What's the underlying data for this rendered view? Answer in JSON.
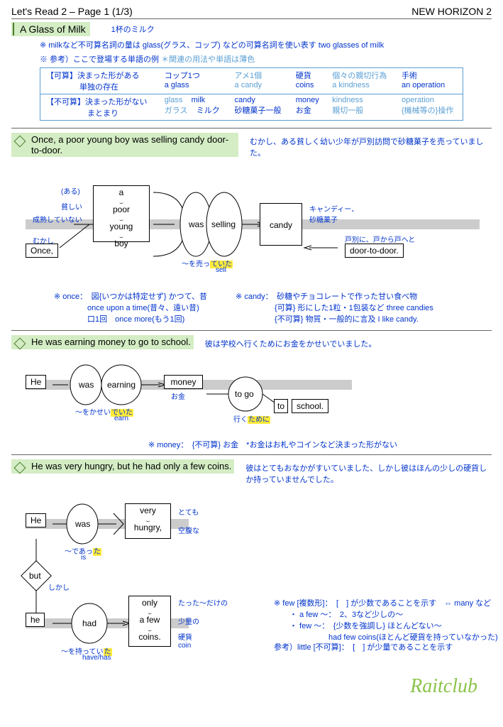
{
  "header": {
    "left": "Let's Read 2 – Page 1 (1/3)",
    "right": "NEW HORIZON 2"
  },
  "title": {
    "en": "A Glass of Milk",
    "jp": "1杯のミルク"
  },
  "note1": "※ milkなど不可算名詞の量は glass(グラス、コップ) などの可算名詞を使い表す two glasses of milk",
  "note2": "※ 参考）ここで登場する単語の例",
  "note2b": "＊関連の用法や単語は薄色",
  "vocab": {
    "r1_label": "【可算】決まった形がある\n　　　　 単独の存在",
    "r1c1": "コップ1つ",
    "r1c1b": "a glass",
    "r1c2": "アメ1個",
    "r1c2b": "a candy",
    "r1c3": "硬貨",
    "r1c3b": "coins",
    "r1c4": "個々の親切行為",
    "r1c4b": "a kindness",
    "r1c5": "手術",
    "r1c5b": "an operation",
    "r2_label": "【不可算】決まった形がない\n　　　　　 まとまり",
    "r2c1a": "glass",
    "r2c1aj": "ガラス",
    "r2c1b": "milk",
    "r2c1bj": "ミルク",
    "r2c2": "candy",
    "r2c2j": "砂糖菓子一般",
    "r2c3": "money",
    "r2c3j": "お金",
    "r2c4": "kindness",
    "r2c4j": "親切一般",
    "r2c5": "operation",
    "r2c5j": "{機械等の}操作"
  },
  "s1": {
    "en": "Once, a poor young boy was selling candy door-to-door.",
    "jp": "むかし、ある貧しく幼い少年が戸別訪問で砂糖菓子を売っていました。",
    "once": "Once,",
    "once_jp": "むかし",
    "a": "a",
    "poor": "poor",
    "young": "young",
    "boy": "boy",
    "a_jp": "(ある)",
    "poor_jp": "貧しい",
    "young_jp": "成熟していない",
    "was": "was",
    "selling": "selling",
    "sell_jp1": "～を売っ",
    "sell_jp2": "ていた",
    "sell_jp3": "sell",
    "candy": "candy",
    "candy_jp": "キャンディー、\n砂糖菓子",
    "door": "door-to-door.",
    "door_jp": "戸別に、戸から戸へと",
    "n1": "※ once：　図{いつかは特定せず} かつて、昔\n　　　　 once upon a time(昔々、遠い昔)\n　　　　 口1回　once more(もう1回)",
    "n2": "※ candy：　砂糖やチョコレートで作った甘い食べ物\n　　　　　{可算} 形にした1粒・1包装など three candies\n　　　　　{不可算} 物質・一般的に言及 I like candy."
  },
  "s2": {
    "en": "He was earning money to go to school.",
    "jp": "彼は学校へ行くためにお金をかせいでいました。",
    "he": "He",
    "was": "was",
    "earning": "earning",
    "money": "money",
    "earn_jp1": "～をかせい",
    "earn_jp2": "でいた",
    "earn_jp3": "earn",
    "money_jp": "お金",
    "togo": "to go",
    "togo_jp1": "行く",
    "togo_jp2": "ために",
    "to": "to",
    "school": "school.",
    "note": "※ money：　{不可算} お金　*お金はお札やコインなど決まった形がない"
  },
  "s3": {
    "en": "He was very hungry, but he had only a few coins.",
    "jp": "彼はとてもおなかがすいていました、しかし彼はほんの少しの硬貨しか持っていませんでした。",
    "he": "He",
    "was": "was",
    "very": "very",
    "hungry": "hungry,",
    "was_jp1": "～であっ",
    "was_jp2": "た",
    "was_jp3": "is",
    "very_jp": "とても",
    "hungry_jp": "空腹な",
    "but": "but",
    "but_jp": "しかし",
    "he2": "he",
    "had": "had",
    "only": "only",
    "afew": "a few",
    "coins": "coins.",
    "had_jp1": "～を持ってい",
    "had_jp2": "た",
    "had_jp3": "have/has",
    "only_jp": "たった～だけの",
    "afew_jp": "少量の",
    "coins_jp": "硬貨\ncoin",
    "n1": "※ few [複数形]：　[　] が少数であることを示す　⇔ many など\n　　・ a few ～：　2、3など少しの～\n　　・ few ～：　{少数を強調し} ほとんどない～\n　　　　　　　had few coins(ほとんど硬貨を持っていなかった)",
    "n2": "参考）little [不可算]：　[　] が少量であることを示す"
  },
  "watermark": "Raitclub"
}
